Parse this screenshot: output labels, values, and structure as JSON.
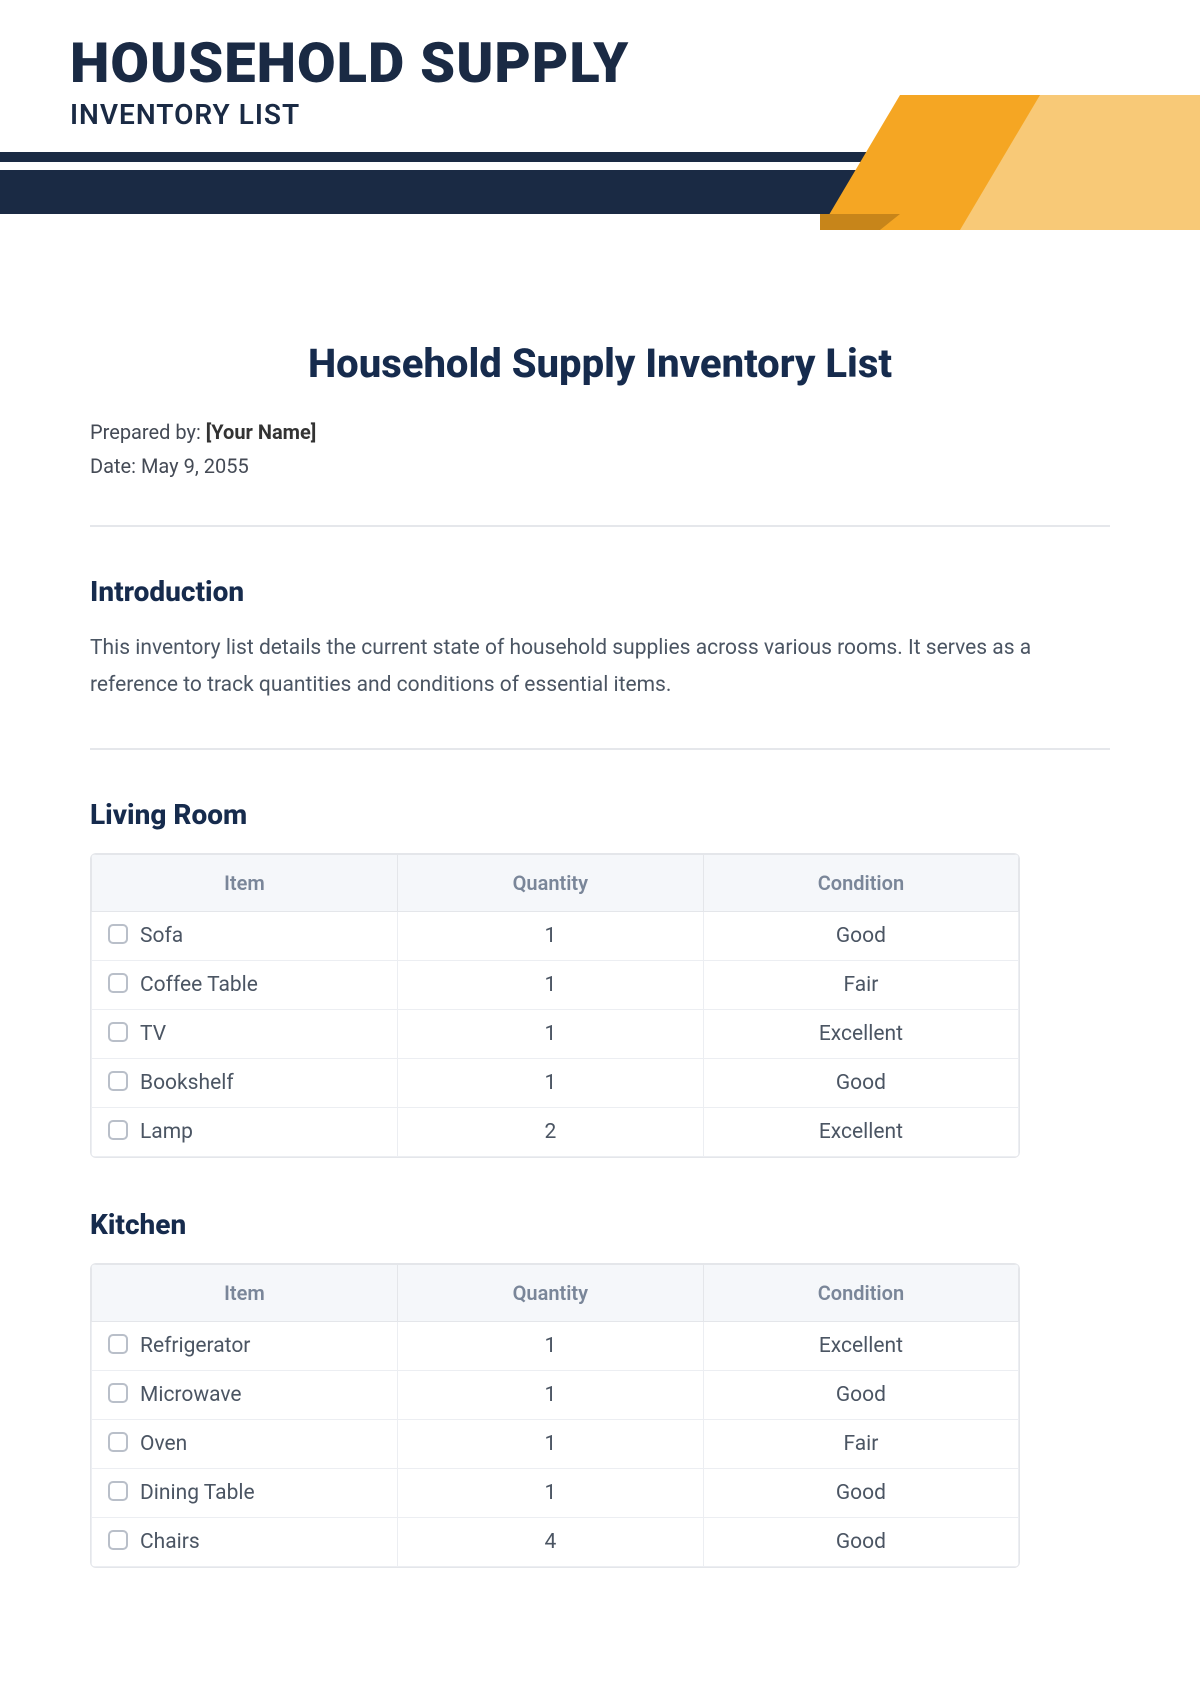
{
  "banner": {
    "title_main": "HOUSEHOLD SUPPLY",
    "title_sub": "INVENTORY LIST"
  },
  "doc_title": "Household Supply Inventory List",
  "meta": {
    "prepared_label": "Prepared by: ",
    "prepared_value": "[Your Name]",
    "date_label": "Date: ",
    "date_value": "May 9, 2055"
  },
  "intro": {
    "heading": "Introduction",
    "body": "This inventory list details the current state of household supplies across various rooms. It serves as a reference to track quantities and conditions of essential items."
  },
  "columns": {
    "item": "Item",
    "quantity": "Quantity",
    "condition": "Condition"
  },
  "sections": [
    {
      "heading": "Living Room",
      "rows": [
        {
          "item": "Sofa",
          "quantity": "1",
          "condition": "Good"
        },
        {
          "item": "Coffee Table",
          "quantity": "1",
          "condition": "Fair"
        },
        {
          "item": "TV",
          "quantity": "1",
          "condition": "Excellent"
        },
        {
          "item": "Bookshelf",
          "quantity": "1",
          "condition": "Good"
        },
        {
          "item": "Lamp",
          "quantity": "2",
          "condition": "Excellent"
        }
      ]
    },
    {
      "heading": "Kitchen",
      "rows": [
        {
          "item": "Refrigerator",
          "quantity": "1",
          "condition": "Excellent"
        },
        {
          "item": "Microwave",
          "quantity": "1",
          "condition": "Good"
        },
        {
          "item": "Oven",
          "quantity": "1",
          "condition": "Fair"
        },
        {
          "item": "Dining Table",
          "quantity": "1",
          "condition": "Good"
        },
        {
          "item": "Chairs",
          "quantity": "4",
          "condition": "Good"
        }
      ]
    }
  ],
  "colors": {
    "navy": "#1a2a44",
    "orange": "#f5a623",
    "orange_light": "#f8c977",
    "orange_dark": "#c7851a"
  }
}
